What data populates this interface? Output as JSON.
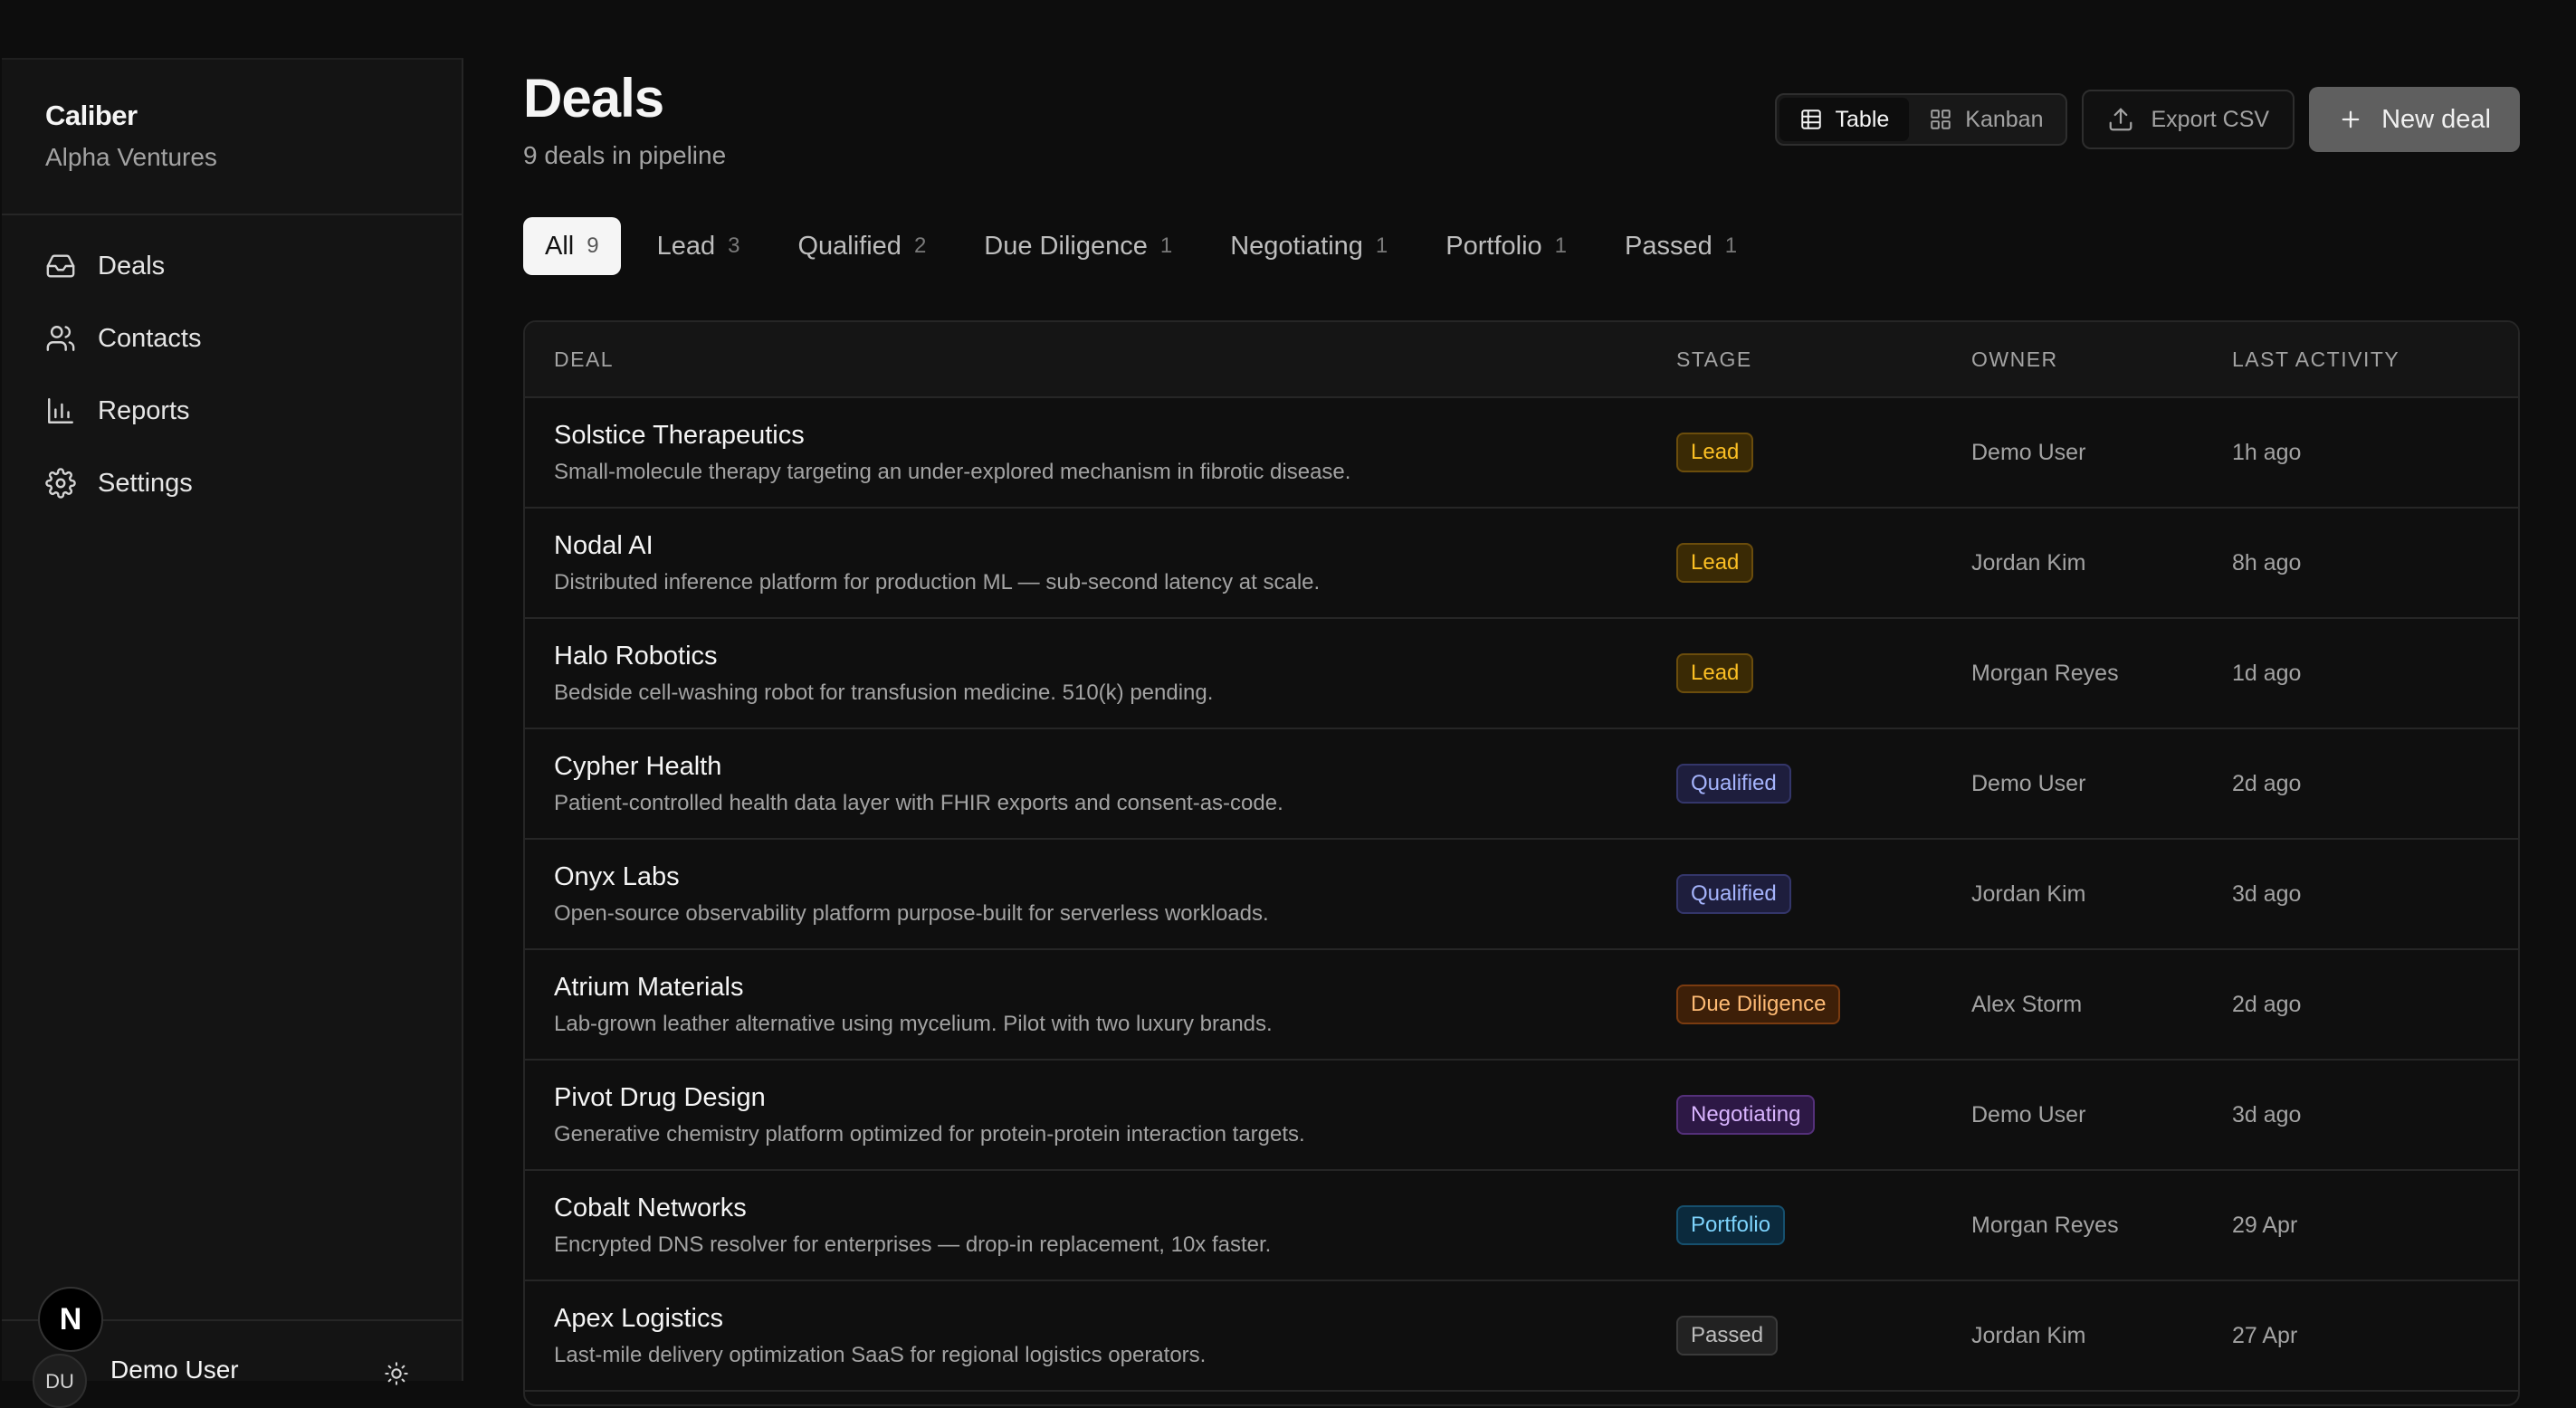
{
  "sidebar": {
    "brand": "Caliber",
    "org": "Alpha Ventures",
    "nav": [
      {
        "label": "Deals",
        "icon": "inbox-icon"
      },
      {
        "label": "Contacts",
        "icon": "users-icon"
      },
      {
        "label": "Reports",
        "icon": "bar-chart-icon"
      },
      {
        "label": "Settings",
        "icon": "gear-icon"
      }
    ],
    "user": {
      "initials": "DU",
      "name": "Demo User"
    },
    "next_badge": "N"
  },
  "header": {
    "title": "Deals",
    "subtitle": "9 deals in pipeline"
  },
  "toolbar": {
    "view_table": "Table",
    "view_kanban": "Kanban",
    "export": "Export CSV",
    "new_deal": "New deal"
  },
  "tabs": [
    {
      "label": "All",
      "count": "9"
    },
    {
      "label": "Lead",
      "count": "3"
    },
    {
      "label": "Qualified",
      "count": "2"
    },
    {
      "label": "Due Diligence",
      "count": "1"
    },
    {
      "label": "Negotiating",
      "count": "1"
    },
    {
      "label": "Portfolio",
      "count": "1"
    },
    {
      "label": "Passed",
      "count": "1"
    }
  ],
  "table": {
    "headers": [
      "DEAL",
      "STAGE",
      "OWNER",
      "LAST ACTIVITY"
    ],
    "rows": [
      {
        "name": "Solstice Therapeutics",
        "desc": "Small-molecule therapy targeting an under-explored mechanism in fibrotic disease.",
        "stage": "Lead",
        "owner": "Demo User",
        "activity": "1h ago"
      },
      {
        "name": "Nodal AI",
        "desc": "Distributed inference platform for production ML — sub-second latency at scale.",
        "stage": "Lead",
        "owner": "Jordan Kim",
        "activity": "8h ago"
      },
      {
        "name": "Halo Robotics",
        "desc": "Bedside cell-washing robot for transfusion medicine. 510(k) pending.",
        "stage": "Lead",
        "owner": "Morgan Reyes",
        "activity": "1d ago"
      },
      {
        "name": "Cypher Health",
        "desc": "Patient-controlled health data layer with FHIR exports and consent-as-code.",
        "stage": "Qualified",
        "owner": "Demo User",
        "activity": "2d ago"
      },
      {
        "name": "Onyx Labs",
        "desc": "Open-source observability platform purpose-built for serverless workloads.",
        "stage": "Qualified",
        "owner": "Jordan Kim",
        "activity": "3d ago"
      },
      {
        "name": "Atrium Materials",
        "desc": "Lab-grown leather alternative using mycelium. Pilot with two luxury brands.",
        "stage": "Due Diligence",
        "owner": "Alex Storm",
        "activity": "2d ago"
      },
      {
        "name": "Pivot Drug Design",
        "desc": "Generative chemistry platform optimized for protein-protein interaction targets.",
        "stage": "Negotiating",
        "owner": "Demo User",
        "activity": "3d ago"
      },
      {
        "name": "Cobalt Networks",
        "desc": "Encrypted DNS resolver for enterprises — drop-in replacement, 10x faster.",
        "stage": "Portfolio",
        "owner": "Morgan Reyes",
        "activity": "29 Apr"
      },
      {
        "name": "Apex Logistics",
        "desc": "Last-mile delivery optimization SaaS for regional logistics operators.",
        "stage": "Passed",
        "owner": "Jordan Kim",
        "activity": "27 Apr"
      }
    ]
  },
  "stage_colors": {
    "Lead": "#fbbf24",
    "Qualified": "#a5b4fc",
    "Due Diligence": "#fdba74",
    "Negotiating": "#d8b4fe",
    "Portfolio": "#7dd3fc",
    "Passed": "#bdbdbd"
  }
}
